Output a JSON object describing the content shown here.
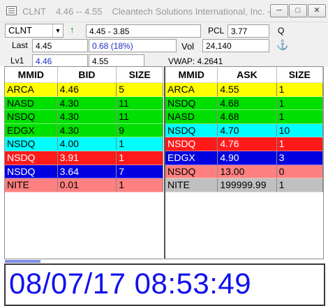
{
  "window": {
    "symbol": "CLNT",
    "range": "4.46 -- 4.55",
    "title": "Cleantech Solutions International, Inc. - C..."
  },
  "quote": {
    "symbol": "CLNT",
    "range": "4.45 - 3.85",
    "pcl_label": "PCL",
    "pcl_value": "3.77",
    "q_label": "Q",
    "last_label": "Last",
    "last_value": "4.45",
    "change": "0.68  (18%)",
    "vol_label": "Vol",
    "vol_value": "24,140",
    "lv1_label": "Lv1",
    "lv1_bid": "4.46",
    "lv1_ask": "4.55",
    "vwap": "VWAP: 4.2641"
  },
  "bid_book": {
    "headers": [
      "MMID",
      "BID",
      "SIZE"
    ],
    "rows": [
      {
        "mmid": "ARCA",
        "price": "4.46",
        "size": "5",
        "bg": "#ffff00",
        "fg": "#000000"
      },
      {
        "mmid": "NASD",
        "price": "4.30",
        "size": "11",
        "bg": "#00e000",
        "fg": "#000000"
      },
      {
        "mmid": "NSDQ",
        "price": "4.30",
        "size": "11",
        "bg": "#00e000",
        "fg": "#000000"
      },
      {
        "mmid": "EDGX",
        "price": "4.30",
        "size": "9",
        "bg": "#00e000",
        "fg": "#000000"
      },
      {
        "mmid": "NSDQ",
        "price": "4.00",
        "size": "1",
        "bg": "#00ffff",
        "fg": "#000000"
      },
      {
        "mmid": "NSDQ",
        "price": "3.91",
        "size": "1",
        "bg": "#ff1a1a",
        "fg": "#ffffff"
      },
      {
        "mmid": "NSDQ",
        "price": "3.64",
        "size": "7",
        "bg": "#0000e0",
        "fg": "#ffffff"
      },
      {
        "mmid": "NITE",
        "price": "0.01",
        "size": "1",
        "bg": "#ff8080",
        "fg": "#000000"
      }
    ]
  },
  "ask_book": {
    "headers": [
      "MMID",
      "ASK",
      "SIZE"
    ],
    "rows": [
      {
        "mmid": "ARCA",
        "price": "4.55",
        "size": "1",
        "bg": "#ffff00",
        "fg": "#000000"
      },
      {
        "mmid": "NSDQ",
        "price": "4.68",
        "size": "1",
        "bg": "#00e000",
        "fg": "#000000"
      },
      {
        "mmid": "NASD",
        "price": "4.68",
        "size": "1",
        "bg": "#00e000",
        "fg": "#000000"
      },
      {
        "mmid": "NSDQ",
        "price": "4.70",
        "size": "10",
        "bg": "#00ffff",
        "fg": "#000000"
      },
      {
        "mmid": "NSDQ",
        "price": "4.76",
        "size": "1",
        "bg": "#ff1a1a",
        "fg": "#ffffff"
      },
      {
        "mmid": "EDGX",
        "price": "4.90",
        "size": "3",
        "bg": "#0000e0",
        "fg": "#ffffff"
      },
      {
        "mmid": "NSDQ",
        "price": "13.00",
        "size": "0",
        "bg": "#ff8080",
        "fg": "#000000"
      },
      {
        "mmid": "NITE",
        "price": "199999.99",
        "size": "1",
        "bg": "#c0c0c0",
        "fg": "#000000"
      }
    ]
  },
  "clock": "08/07/17 08:53:49",
  "icons": {
    "app": "app-icon",
    "minimize": "minimize-icon",
    "maximize": "maximize-icon",
    "close": "close-icon",
    "uptick": "arrow-up-icon",
    "anchor": "anchor-icon"
  },
  "loading_progress": 0.11
}
